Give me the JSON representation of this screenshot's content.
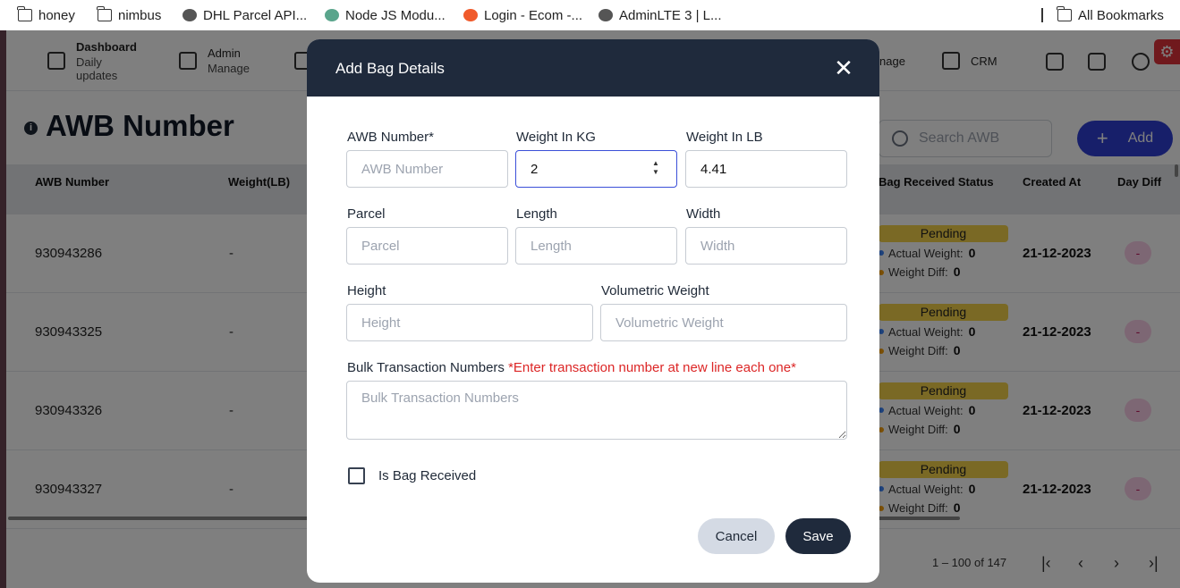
{
  "bookmarks": [
    {
      "label": "honey",
      "icon": "folder-icon"
    },
    {
      "label": "nimbus",
      "icon": "folder-icon"
    },
    {
      "label": "DHL Parcel API...",
      "icon": "globe-icon"
    },
    {
      "label": "Node JS Modu...",
      "icon": "node-icon"
    },
    {
      "label": "Login - Ecom -...",
      "icon": "ecom-icon"
    },
    {
      "label": "AdminLTE 3 | L...",
      "icon": "globe-icon"
    }
  ],
  "all_bookmarks": "All Bookmarks",
  "nav": {
    "dashboard": "Dashboard",
    "dashboard_sub": "Daily updates",
    "admin": "Admin",
    "admin_sub": "Manage",
    "manage_partial": "nage",
    "crm": "CRM"
  },
  "page": {
    "title": "AWB Number",
    "search_placeholder": "Search AWB",
    "add_label": "Add"
  },
  "table": {
    "headers": [
      "AWB Number",
      "Weight(LB)",
      "Bag Received Status",
      "Created At",
      "Day Diff"
    ],
    "rows": [
      {
        "awb": "930943286",
        "weight": "-",
        "status": "Pending",
        "actual_label": "Actual Weight:",
        "actual": "0",
        "diff_label": "Weight Diff:",
        "diff": "0",
        "created": "21-12-2023",
        "day_diff": "-"
      },
      {
        "awb": "930943325",
        "weight": "-",
        "status": "Pending",
        "actual_label": "Actual Weight:",
        "actual": "0",
        "diff_label": "Weight Diff:",
        "diff": "0",
        "created": "21-12-2023",
        "day_diff": "-"
      },
      {
        "awb": "930943326",
        "weight": "-",
        "status": "Pending",
        "actual_label": "Actual Weight:",
        "actual": "0",
        "diff_label": "Weight Diff:",
        "diff": "0",
        "created": "21-12-2023",
        "day_diff": "-"
      },
      {
        "awb": "930943327",
        "weight": "-",
        "status": "Pending",
        "actual_label": "Actual Weight:",
        "actual": "0",
        "diff_label": "Weight Diff:",
        "diff": "0",
        "created": "21-12-2023",
        "day_diff": "-"
      }
    ]
  },
  "pagination": {
    "range": "1 – 100 of 147"
  },
  "modal": {
    "title": "Add Bag Details",
    "fields": {
      "awb_label": "AWB Number*",
      "awb_placeholder": "AWB Number",
      "kg_label": "Weight In KG",
      "kg_value": "2",
      "lb_label": "Weight In LB",
      "lb_value": "4.41",
      "parcel_label": "Parcel",
      "parcel_placeholder": "Parcel",
      "length_label": "Length",
      "length_placeholder": "Length",
      "width_label": "Width",
      "width_placeholder": "Width",
      "height_label": "Height",
      "height_placeholder": "Height",
      "vol_label": "Volumetric Weight",
      "vol_placeholder": "Volumetric Weight",
      "bulk_label": "Bulk Transaction Numbers",
      "bulk_hint": "*Enter transaction number at new line each one*",
      "bulk_placeholder": "Bulk Transaction Numbers",
      "received_label": "Is Bag Received"
    },
    "cancel_label": "Cancel",
    "save_label": "Save"
  },
  "colors": {
    "modal_header": "#1f2a3c",
    "primary": "#2f3fd4",
    "pending": "#f5d24a",
    "hint_red": "#dc2626"
  }
}
